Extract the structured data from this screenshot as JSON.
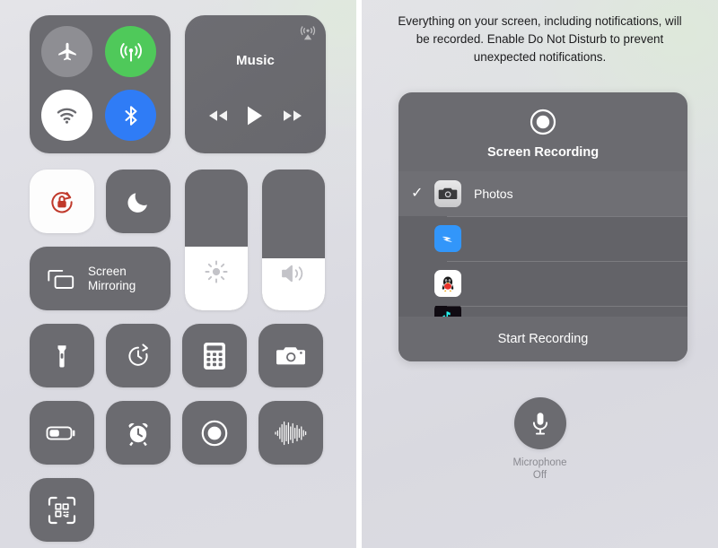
{
  "colors": {
    "background": "#dcdce2",
    "tile": "#6b6b70",
    "tile_active_white": "#fdfdfd",
    "cellular_green": "#4fc95a",
    "bluetooth_blue": "#2f7cf6",
    "airplane_gray": "#8e8e93",
    "rotation_lock_red": "#c0392b",
    "text_white": "#ffffff",
    "text_dark": "#1c1c1e",
    "label_gray": "#8a8a90"
  },
  "left_panel": {
    "connectivity": {
      "buttons": [
        {
          "name": "airplane-mode",
          "icon": "airplane-icon",
          "state": "off"
        },
        {
          "name": "cellular-data",
          "icon": "cellular-icon",
          "state": "on"
        },
        {
          "name": "wifi",
          "icon": "wifi-icon",
          "state": "on"
        },
        {
          "name": "bluetooth",
          "icon": "bluetooth-icon",
          "state": "on"
        }
      ]
    },
    "music": {
      "title": "Music",
      "airplay_icon": "airplay-icon",
      "controls": [
        {
          "name": "rewind",
          "icon": "rewind-icon"
        },
        {
          "name": "play",
          "icon": "play-icon"
        },
        {
          "name": "fast-forward",
          "icon": "fast-forward-icon"
        }
      ]
    },
    "rotation_lock": {
      "icon": "rotation-lock-icon",
      "state": "on"
    },
    "do_not_disturb": {
      "icon": "moon-icon",
      "state": "off"
    },
    "screen_mirroring": {
      "label_line1": "Screen",
      "label_line2": "Mirroring",
      "icon": "screen-mirroring-icon"
    },
    "brightness_slider": {
      "icon": "brightness-icon",
      "value_percent": 45
    },
    "volume_slider": {
      "icon": "volume-icon",
      "value_percent": 37
    },
    "shortcuts": [
      {
        "name": "flashlight",
        "icon": "flashlight-icon"
      },
      {
        "name": "timer",
        "icon": "timer-icon"
      },
      {
        "name": "calculator",
        "icon": "calculator-icon"
      },
      {
        "name": "camera",
        "icon": "camera-icon"
      },
      {
        "name": "low-power-mode",
        "icon": "battery-icon"
      },
      {
        "name": "alarm",
        "icon": "alarm-clock-icon"
      },
      {
        "name": "screen-recording",
        "icon": "record-icon"
      },
      {
        "name": "hearing",
        "icon": "waveform-icon"
      },
      {
        "name": "qr-code-reader",
        "icon": "qr-code-icon"
      }
    ]
  },
  "right_panel": {
    "notice": "Everything on your screen, including notifications, will be recorded. Enable Do Not Disturb to prevent unexpected notifications.",
    "dialog": {
      "icon": "record-icon",
      "title": "Screen Recording",
      "apps": [
        {
          "name": "Photos",
          "icon": "photos-camera-icon",
          "selected": true
        },
        {
          "name": "",
          "icon": "dingtalk-icon",
          "selected": false
        },
        {
          "name": "",
          "icon": "qq-penguin-icon",
          "selected": false
        },
        {
          "name": "",
          "icon": "dark-app-icon",
          "selected": false
        }
      ],
      "start_button": "Start Recording"
    },
    "microphone": {
      "icon": "microphone-icon",
      "label_line1": "Microphone",
      "label_line2": "Off",
      "state": "off"
    }
  }
}
